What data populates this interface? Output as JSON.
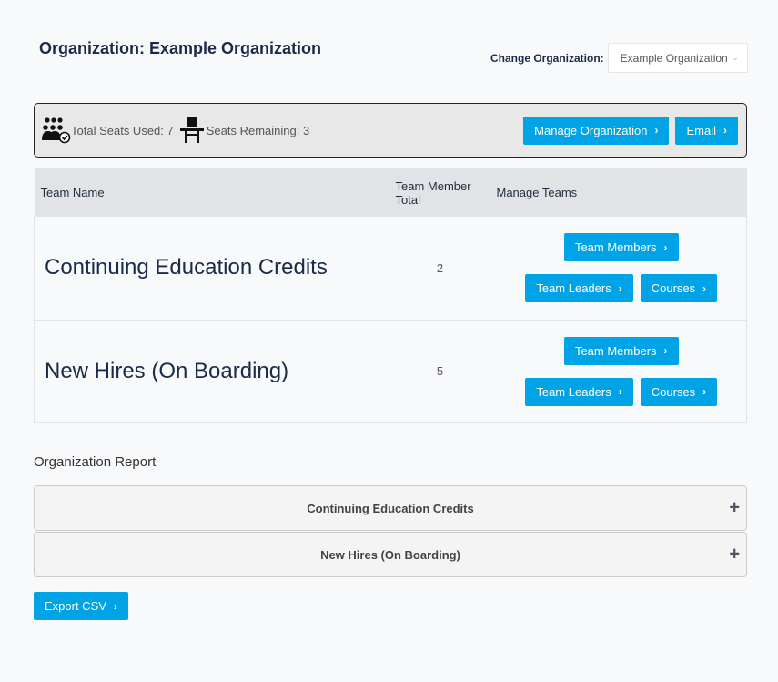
{
  "header": {
    "title": "Organization: Example Organization",
    "change_org_label": "Change Organization:",
    "selected_org": "Example Organization"
  },
  "seats": {
    "used_label": "Total Seats Used: 7",
    "remaining_label": "Seats Remaining: 3",
    "icons": {
      "used": "group-check-icon",
      "remaining": "desk-chair-icon"
    }
  },
  "actions": {
    "manage_org": "Manage Organization",
    "email": "Email"
  },
  "table": {
    "headers": [
      "Team Name",
      "Team Member Total",
      "Manage Teams"
    ],
    "header_total_line1": "Team Member",
    "header_total_line2": "Total",
    "rows": [
      {
        "name": "Continuing Education Credits",
        "total": "2",
        "buttons": {
          "members": "Team Members",
          "leaders": "Team Leaders",
          "courses": "Courses"
        }
      },
      {
        "name": "New Hires (On Boarding)",
        "total": "5",
        "buttons": {
          "members": "Team Members",
          "leaders": "Team Leaders",
          "courses": "Courses"
        }
      }
    ]
  },
  "report": {
    "title": "Organization Report",
    "items": [
      {
        "label": "Continuing Education Credits",
        "icon": "+"
      },
      {
        "label": "New Hires (On Boarding)",
        "icon": "+"
      }
    ],
    "export_label": "Export CSV"
  },
  "arrow_glyph": "›",
  "chevron_glyph": "⌄",
  "colors": {
    "primary": "#00a3e6",
    "title": "#1a2b47"
  }
}
